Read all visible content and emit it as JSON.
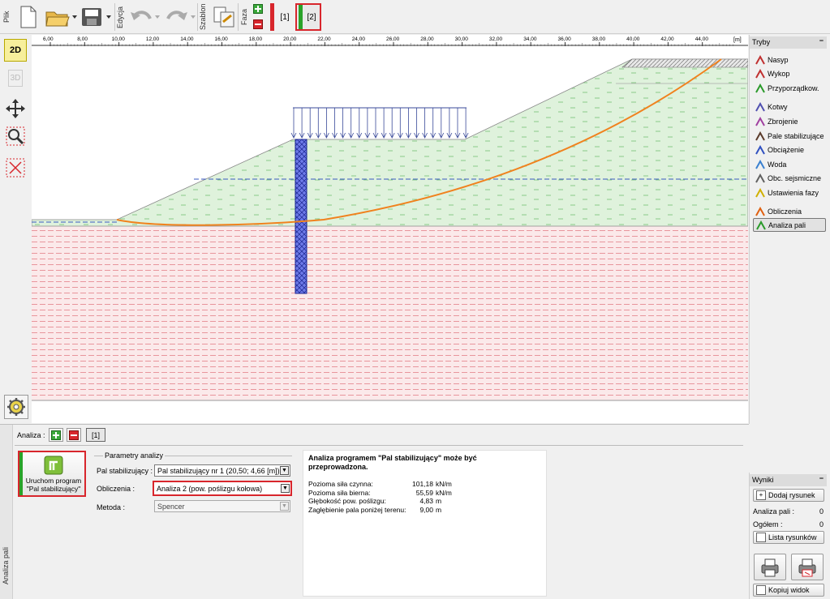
{
  "toolbar": {
    "file_label": "Plik",
    "edit_label": "Edycja",
    "template_label": "Szablon",
    "phase_label": "Faza",
    "phase1": "[1]",
    "phase2": "[2]"
  },
  "left_tools": {
    "view2d": "2D",
    "view3d": "3D"
  },
  "ruler": {
    "ticks": [
      "6,00",
      "8,00",
      "10,00",
      "12,00",
      "14,00",
      "16,00",
      "18,00",
      "20,00",
      "22,00",
      "24,00",
      "26,00",
      "28,00",
      "30,00",
      "32,00",
      "34,00",
      "36,00",
      "38,00",
      "40,00",
      "42,00",
      "44,00"
    ],
    "unit": "[m]"
  },
  "modes": {
    "title": "Tryby",
    "items": [
      "Nasyp",
      "Wykop",
      "Przyporządkow.",
      "Kotwy",
      "Zbrojenie",
      "Pale stabilizujące",
      "Obciążenie",
      "Woda",
      "Obc. sejsmiczne",
      "Ustawienia fazy",
      "Obliczenia",
      "Analiza pali"
    ]
  },
  "analysis_bar": {
    "label": "Analiza :",
    "tab": "[1]"
  },
  "side_label": "Analiza pali",
  "run_button": {
    "line1": "Uruchom program",
    "line2": "\"Pal stabilizujący\""
  },
  "params": {
    "group_title": "Parametry analizy",
    "pile_label": "Pal stabilizujący :",
    "pile_value": "Pal stabilizujący nr 1 (20,50; 4,66 [m])",
    "calc_label": "Obliczenia :",
    "calc_value": "Analiza 2 (pow. poślizgu kołowa)",
    "method_label": "Metoda :",
    "method_value": "Spencer"
  },
  "results_text": {
    "heading1": "Analiza programem \"Pal stabilizujący\" może być",
    "heading2": "przeprowadzona.",
    "rows": [
      {
        "label": "Pozioma siła czynna:",
        "value": "101,18",
        "unit": "kN/m"
      },
      {
        "label": "Pozioma siła bierna:",
        "value": "55,59",
        "unit": "kN/m"
      },
      {
        "label": "Głębokość pow. poślizgu:",
        "value": "4,83",
        "unit": "m"
      },
      {
        "label": "Zagłębienie pala poniżej terenu:",
        "value": "9,00",
        "unit": "m"
      }
    ]
  },
  "results_panel": {
    "title": "Wyniki",
    "add_drawing": "Dodaj rysunek",
    "pile_analysis_label": "Analiza pali :",
    "pile_analysis_count": "0",
    "total_label": "Ogółem :",
    "total_count": "0",
    "drawings_list": "Lista rysunków",
    "copy_view": "Kopiuj widok"
  },
  "colors": {
    "accent_red": "#d8262c",
    "accent_green": "#2aa32a",
    "slip_surface": "#f0821e",
    "pile": "#3040c0",
    "soil_upper": "#dff2dc",
    "soil_lower": "#fbe9ea"
  }
}
